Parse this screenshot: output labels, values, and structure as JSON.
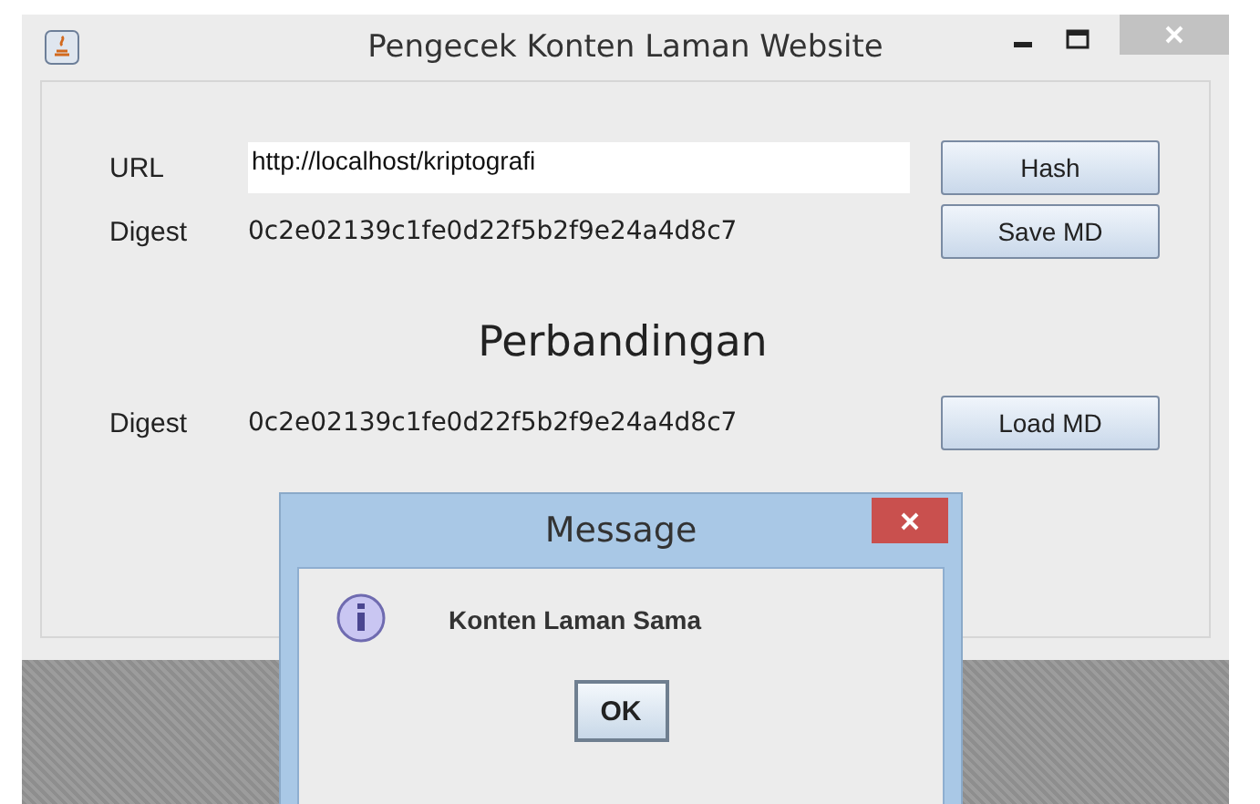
{
  "window": {
    "title": "Pengecek Konten Laman Website"
  },
  "form": {
    "url_label": "URL",
    "url_value": "http://localhost/kriptografi",
    "hash_button": "Hash",
    "digest_label": "Digest",
    "digest_value": "0c2e02139c1fe0d22f5b2f9e24a4d8c7",
    "save_button": "Save MD"
  },
  "comparison": {
    "heading": "Perbandingan",
    "digest_label": "Digest",
    "digest_value": "0c2e02139c1fe0d22f5b2f9e24a4d8c7",
    "load_button": "Load MD"
  },
  "dialog": {
    "title": "Message",
    "message": "Konten Laman Sama",
    "ok_button": "OK"
  }
}
